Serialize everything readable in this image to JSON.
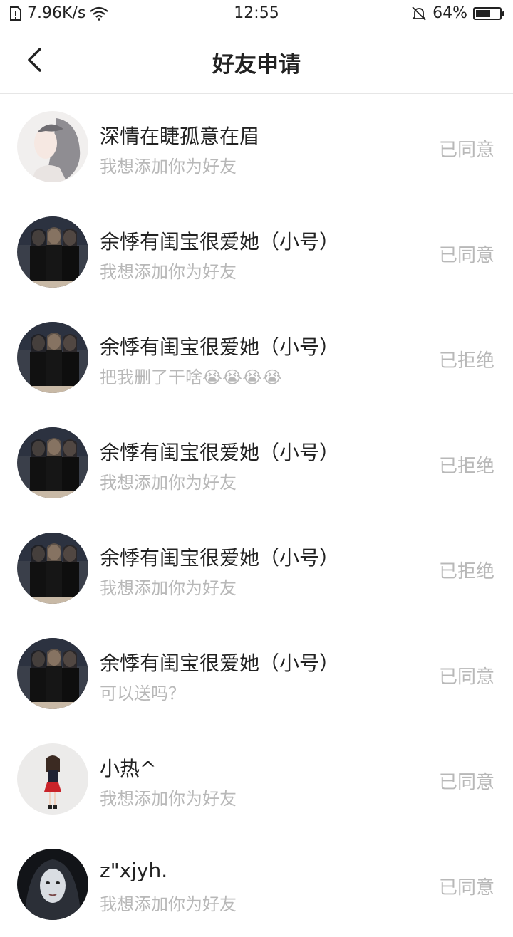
{
  "status_bar": {
    "network_speed": "7.96K/s",
    "time": "12:55",
    "battery_percent": "64%",
    "battery_level": 0.64
  },
  "header": {
    "title": "好友申请"
  },
  "requests": [
    {
      "name": "深情在睫孤意在眉",
      "message": "我想添加你为好友",
      "status": "已同意",
      "avatar": "girl-sketch"
    },
    {
      "name": "余悸有闺宝很爱她（小号）",
      "message": "我想添加你为好友",
      "status": "已同意",
      "avatar": "group-photo"
    },
    {
      "name": "余悸有闺宝很爱她（小号）",
      "message": "把我删了干啥😭😭😭😭",
      "status": "已拒绝",
      "avatar": "group-photo"
    },
    {
      "name": "余悸有闺宝很爱她（小号）",
      "message": "我想添加你为好友",
      "status": "已拒绝",
      "avatar": "group-photo"
    },
    {
      "name": "余悸有闺宝很爱她（小号）",
      "message": "我想添加你为好友",
      "status": "已拒绝",
      "avatar": "group-photo"
    },
    {
      "name": "余悸有闺宝很爱她（小号）",
      "message": "可以送吗？",
      "status": "已同意",
      "avatar": "group-photo"
    },
    {
      "name": "小热^",
      "message": "我想添加你为好友",
      "status": "已同意",
      "avatar": "cartoon-girl"
    },
    {
      "name": "z\"xjyh.",
      "message": "我想添加你为好友",
      "status": "已同意",
      "avatar": "dark-portrait"
    }
  ],
  "colors": {
    "text_primary": "#222222",
    "text_secondary": "#b8b8b8",
    "divider": "#e6e6e6"
  }
}
